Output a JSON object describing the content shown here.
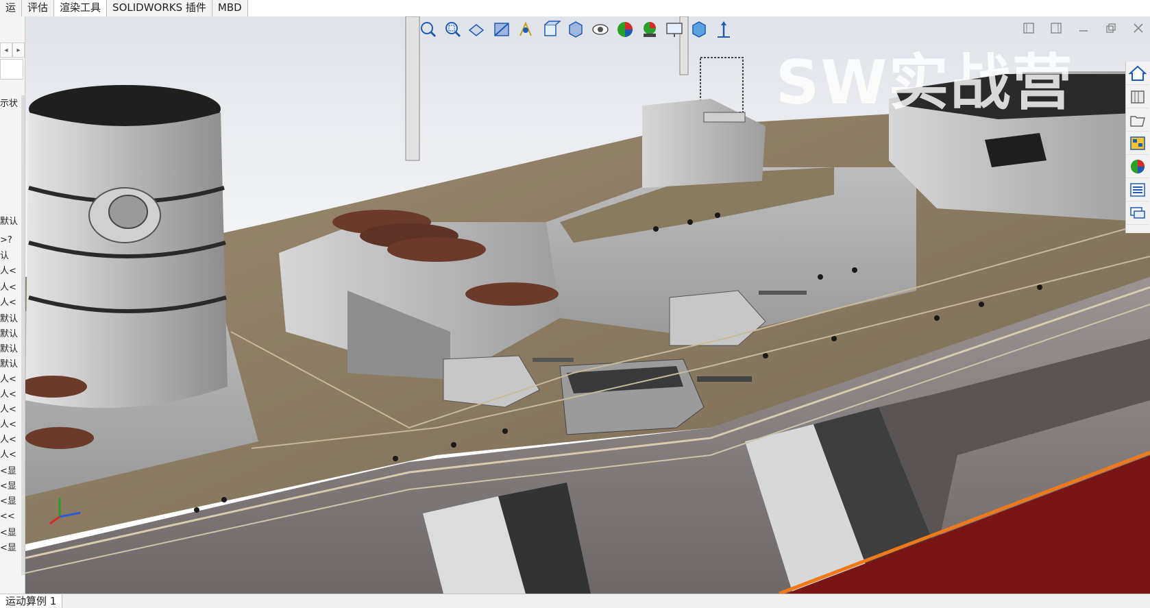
{
  "ribbon": {
    "tabs": [
      {
        "label": "运"
      },
      {
        "label": "评估"
      },
      {
        "label": "渲染工具"
      },
      {
        "label": "SOLIDWORKS 插件"
      },
      {
        "label": "MBD"
      }
    ]
  },
  "feature_tree": {
    "nav_left": "◂",
    "nav_right": "▸",
    "rows": [
      "示状",
      "默认",
      ">?",
      "认",
      "人<",
      "人<",
      "人<",
      "默认",
      "默认",
      "默认",
      "默认",
      "人<",
      "人<",
      "人<",
      "人<",
      "人<",
      "人<",
      "<显",
      "<显",
      "<显",
      "<<",
      "<显",
      "<显"
    ]
  },
  "heads_up_toolbar": {
    "icons": [
      "zoom-to-fit-icon",
      "zoom-area-icon",
      "previous-view-icon",
      "section-view-icon",
      "dynamic-annotation-icon",
      "view-orientation-icon",
      "display-style-icon",
      "hide-show-items-icon",
      "edit-appearance-icon",
      "apply-scene-icon",
      "view-settings-icon",
      "display-pane-icon",
      "triad-icon"
    ]
  },
  "window_controls": [
    "tile-left-icon",
    "tile-right-icon",
    "minimize-icon",
    "restore-icon",
    "close-icon"
  ],
  "task_pane": {
    "icons": [
      "home-icon",
      "design-library-icon",
      "file-explorer-icon",
      "view-palette-icon",
      "appearances-icon",
      "custom-properties-icon",
      "forum-icon"
    ]
  },
  "watermark": {
    "text": "SW实战营"
  },
  "status_bar": {
    "motion_study_tab": "运动算例 1"
  },
  "colors": {
    "hull_gray": "#8a8383",
    "deck_tan": "#8c7a62",
    "boot_red": "#7a1515",
    "stripe_orange": "#f07a1a",
    "lifeboat_brown": "#6b3a2a"
  }
}
